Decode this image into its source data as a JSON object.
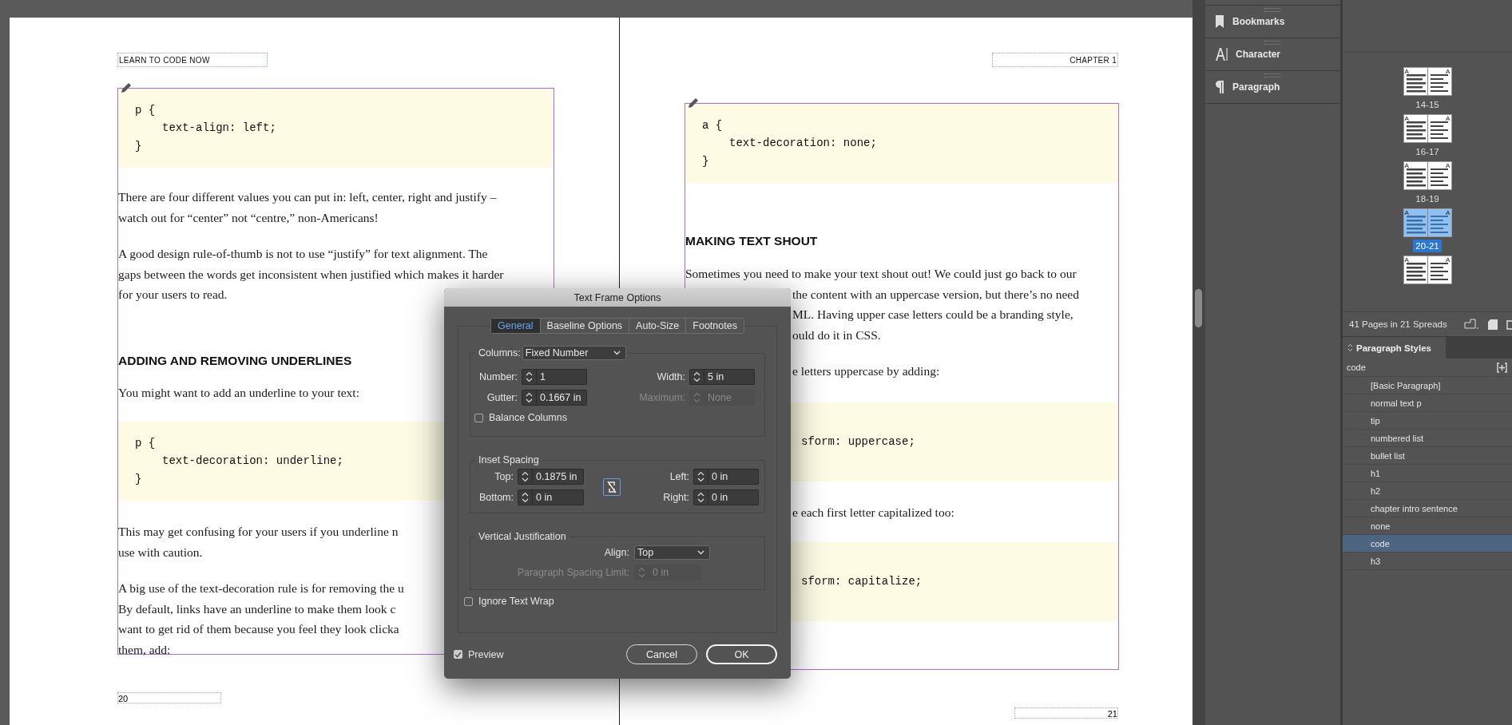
{
  "document": {
    "left_page": {
      "header": "LEARN TO CODE NOW",
      "page_number": "20",
      "blocks": [
        {
          "kind": "code",
          "lines": [
            {
              "text": "p {",
              "children": [
                {
                  "text": "text-align: left;"
                }
              ]
            },
            {
              "text": "}"
            }
          ]
        },
        {
          "kind": "text",
          "lines": [
            "There are four different values you can put in: left, center, right and justify –",
            "watch out for “center” not “centre,” non-Americans!"
          ]
        },
        {
          "kind": "text",
          "lines": [
            "A good design rule-of-thumb is not to use “justify” for text alignment. The",
            "gaps between the words get inconsistent when justified which makes it harder",
            "for your users to read."
          ]
        },
        {
          "kind": "heading",
          "text": "ADDING AND REMOVING UNDERLINES"
        },
        {
          "kind": "text",
          "lines": [
            "You might want to add an underline to your text:"
          ]
        },
        {
          "kind": "code",
          "lines": [
            {
              "text": "p {",
              "children": [
                {
                  "text": "text-decoration: underline;"
                }
              ]
            },
            {
              "text": "}"
            }
          ]
        },
        {
          "kind": "text",
          "lines": [
            "This may get confusing for your users if you underline n",
            "use with caution."
          ]
        },
        {
          "kind": "text",
          "lines": [
            "A big use of the text-decoration rule is for removing the u",
            "By default, links have an underline to make them look c",
            "want to get rid of them because you feel they look clicka",
            "them, add:"
          ]
        }
      ]
    },
    "right_page": {
      "header": "CHAPTER 1",
      "page_number": "21",
      "blocks": [
        {
          "kind": "code",
          "lines": [
            {
              "text": "a {",
              "children": [
                {
                  "text": "text-decoration: none;"
                }
              ]
            },
            {
              "text": "}"
            }
          ]
        },
        {
          "kind": "heading",
          "text": "MAKING TEXT SHOUT"
        },
        {
          "kind": "text",
          "lines": [
            "Sometimes you need to make your text shout out! We could just go back to our"
          ]
        },
        {
          "kind": "text",
          "covered_start": true,
          "lines": [
            "the content with an uppercase version, but there’s no need",
            "ML. Having upper case letters could be a branding style,",
            "ould do it in CSS."
          ]
        },
        {
          "kind": "text",
          "covered_start": true,
          "lines": [
            "e letters uppercase by adding:"
          ]
        },
        {
          "kind": "code",
          "covered_start": true,
          "lines": [
            {
              "text": "sform: uppercase;"
            }
          ]
        },
        {
          "kind": "text",
          "covered_start": true,
          "lines": [
            "e each first letter capitalized too:"
          ]
        },
        {
          "kind": "code",
          "covered_start": true,
          "lines": [
            {
              "text": "sform: capitalize;"
            }
          ]
        }
      ]
    }
  },
  "dialog": {
    "title": "Text Frame Options",
    "tabs": [
      {
        "label": "General",
        "selected": true
      },
      {
        "label": "Baseline Options",
        "selected": false
      },
      {
        "label": "Auto-Size",
        "selected": false
      },
      {
        "label": "Footnotes",
        "selected": false
      }
    ],
    "columns": {
      "label": "Columns:",
      "value": "Fixed Number"
    },
    "column_fields": [
      {
        "label": "Number:",
        "value": "1",
        "disabled": false
      },
      {
        "label": "Width:",
        "value": "5 in",
        "disabled": false
      },
      {
        "label": "Gutter:",
        "value": "0.1667 in",
        "disabled": false
      },
      {
        "label": "Maximum:",
        "value": "None",
        "disabled": true
      }
    ],
    "balance_columns": {
      "label": "Balance Columns",
      "checked": false
    },
    "inset_spacing": {
      "title": "Inset Spacing",
      "fields": [
        {
          "label": "Top:",
          "value": "0.1875 in"
        },
        {
          "label": "Left:",
          "value": "0 in"
        },
        {
          "label": "Bottom:",
          "value": "0 in"
        },
        {
          "label": "Right:",
          "value": "0 in"
        }
      ]
    },
    "vertical_justification": {
      "title": "Vertical Justification",
      "align": {
        "label": "Align:",
        "value": "Top"
      },
      "spacing_limit": {
        "label": "Paragraph Spacing Limit:",
        "value": "0 in",
        "disabled": true
      }
    },
    "ignore_text_wrap": {
      "label": "Ignore Text Wrap",
      "checked": false
    },
    "preview": {
      "label": "Preview",
      "checked": true
    },
    "buttons": [
      "Cancel",
      "OK"
    ]
  },
  "panels": [
    {
      "kind": "bookmark",
      "label": "Bookmarks"
    },
    {
      "kind": "character",
      "label": "Character"
    },
    {
      "kind": "paragraph",
      "label": "Paragraph"
    }
  ],
  "pages_panel": {
    "spreads": [
      {
        "label": "14-15",
        "masters": [
          "A",
          "A"
        ],
        "selected": false
      },
      {
        "label": "16-17",
        "masters": [
          "A",
          "A"
        ],
        "selected": false
      },
      {
        "label": "18-19",
        "masters": [
          "A",
          "A"
        ],
        "selected": false
      },
      {
        "label": "20-21",
        "masters": [
          "A",
          "A"
        ],
        "selected": true
      },
      {
        "masters": [
          "A",
          "A"
        ],
        "selected": false
      }
    ],
    "summary": "41 Pages in 21 Spreads"
  },
  "paragraph_styles": {
    "title": "Paragraph Styles",
    "current": "code",
    "styles": [
      {
        "label": "[Basic Paragraph]",
        "selected": false
      },
      {
        "label": "normal text p",
        "selected": false
      },
      {
        "label": "tip",
        "selected": false
      },
      {
        "label": "numbered list",
        "selected": false
      },
      {
        "label": "bullet list",
        "selected": false
      },
      {
        "label": "h1",
        "selected": false
      },
      {
        "label": "h2",
        "selected": false
      },
      {
        "label": "chapter intro sentence",
        "selected": false
      },
      {
        "label": "none",
        "selected": false
      },
      {
        "label": "code",
        "selected": true
      },
      {
        "label": "h3",
        "selected": false
      }
    ]
  }
}
